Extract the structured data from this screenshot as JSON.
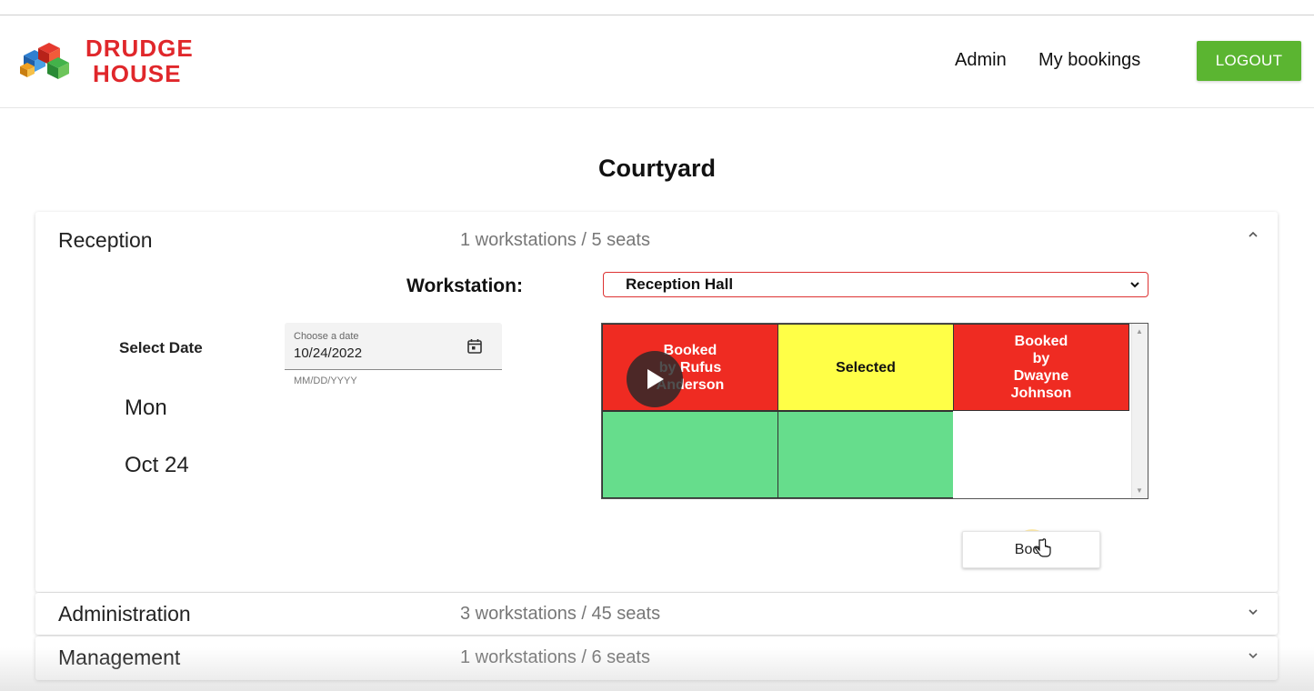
{
  "brand": {
    "line1": "DRUDGE",
    "line2": "HOUSE",
    "color": "#e0272b"
  },
  "nav": {
    "admin": "Admin",
    "my_bookings": "My bookings",
    "logout": "LOGOUT",
    "logout_color": "#5bb531"
  },
  "page": {
    "title": "Courtyard"
  },
  "sections": [
    {
      "name": "Reception",
      "summary": "1 workstations  / 5 seats",
      "expanded": true
    },
    {
      "name": "Administration",
      "summary": "3 workstations  / 45 seats",
      "expanded": false
    },
    {
      "name": "Management",
      "summary": "1 workstations  / 6 seats",
      "expanded": false
    }
  ],
  "reception": {
    "workstation_label": "Workstation:",
    "workstation_value": "Reception Hall",
    "select_date_label": "Select Date",
    "day_name": "Mon",
    "day_date": "Oct 24",
    "date_field": {
      "label": "Choose a date",
      "value": "10/24/2022",
      "hint": "MM/DD/YYYY"
    },
    "seats": [
      {
        "label": "Booked\nby Rufus\nAnderson",
        "status": "booked"
      },
      {
        "label": "Selected",
        "status": "selected"
      },
      {
        "label": "Booked\nby\nDwayne\nJohnson",
        "status": "booked"
      },
      {
        "label": "",
        "status": "free"
      },
      {
        "label": "",
        "status": "free"
      },
      {
        "label": "",
        "status": "empty"
      }
    ],
    "status_colors": {
      "booked": "#ef2b22",
      "selected": "#ffff47",
      "free": "#66dd8c"
    },
    "book_button": "Book"
  }
}
